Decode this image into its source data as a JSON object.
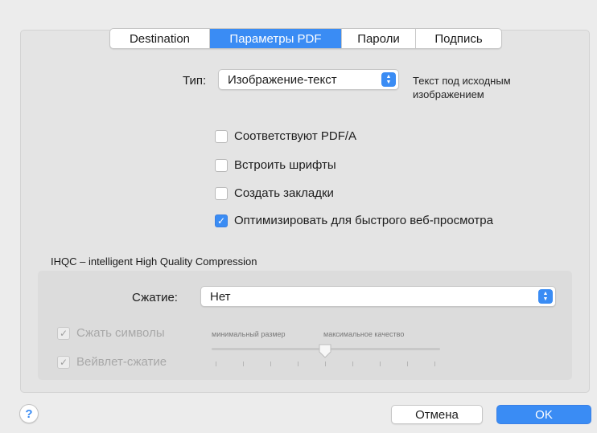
{
  "tabs": [
    {
      "label": "Destination",
      "active": false
    },
    {
      "label": "Параметры PDF",
      "active": true
    },
    {
      "label": "Пароли",
      "active": false
    },
    {
      "label": "Подпись",
      "active": false
    }
  ],
  "type_field": {
    "label": "Тип:",
    "value": "Изображение-текст",
    "hint_line1": "Текст под исходным",
    "hint_line2": "изображением"
  },
  "options": [
    {
      "label": "Соответствуют PDF/A",
      "checked": false
    },
    {
      "label": "Встроить шрифты",
      "checked": false
    },
    {
      "label": "Создать закладки",
      "checked": false
    },
    {
      "label": "Оптимизировать для быстрого веб-просмотра",
      "checked": true
    }
  ],
  "ihqc": {
    "title": "IHQC – intelligent High Quality Compression",
    "compression_label": "Сжатие:",
    "compression_value": "Нет",
    "compress_symbols": {
      "label": "Сжать символы",
      "checked": true,
      "enabled": false
    },
    "wavelet": {
      "label": "Вейвлет-сжатие",
      "checked": true,
      "enabled": false
    },
    "scale_min_label": "минимальный размер",
    "scale_max_label": "максимальное качество",
    "slider_level": 0.5
  },
  "buttons": {
    "help": "?",
    "cancel": "Отмена",
    "ok": "OK"
  },
  "colors": {
    "accent": "#3a8cf4",
    "background": "#ececec"
  }
}
